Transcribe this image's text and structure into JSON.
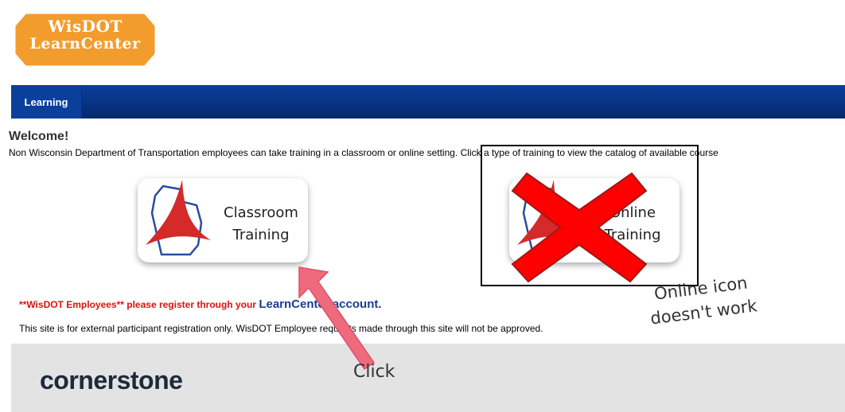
{
  "logo": {
    "line1": "WisDOT",
    "line2": "LearnCenter"
  },
  "nav": {
    "tab_label": "Learning"
  },
  "welcome": {
    "title": "Welcome!",
    "intro": "Non Wisconsin Department of Transportation employees can take training in a classroom or online setting. Click a type of training to view the catalog of available course"
  },
  "tiles": {
    "classroom": {
      "line1": "Classroom",
      "line2": "Training"
    },
    "online": {
      "line1": "Online",
      "line2": "Training"
    }
  },
  "notice": {
    "employees_text": "**WisDOT Employees** please register through your ",
    "employees_link": "LearnCenter account.",
    "external_text": "This site is for external participant registration only. WisDOT Employee requests made through this site will not be approved."
  },
  "footer": {
    "brand": "cornerstone"
  },
  "annotations": {
    "click_label": "Click",
    "online_line1": "Online icon",
    "online_line2": "doesn't work",
    "arrow_color": "#f06a7e",
    "x_color": "#ff0000"
  },
  "colors": {
    "logo_orange": "#f39c2e",
    "nav_blue": "#0a3f9c",
    "notice_red": "#e01010"
  }
}
